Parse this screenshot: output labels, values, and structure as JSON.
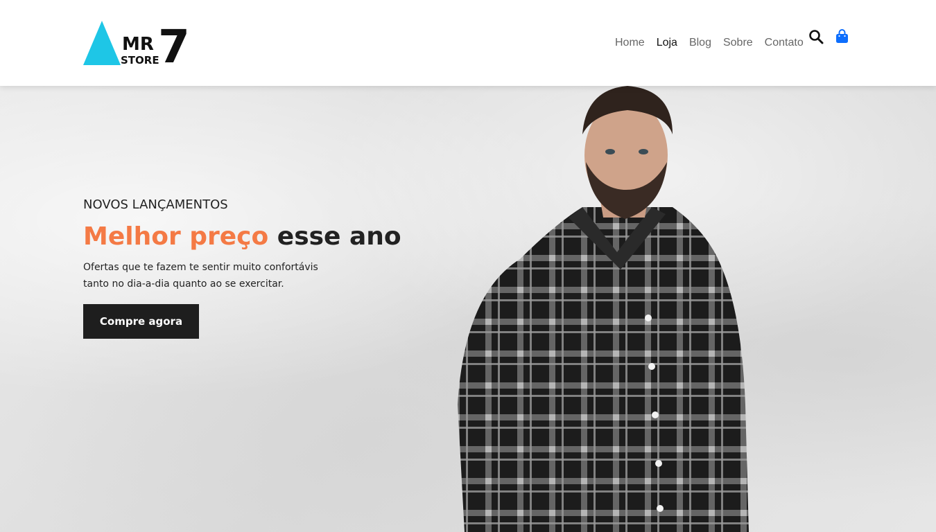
{
  "brand": {
    "logo_text_top": "MR",
    "logo_text_bottom": "STORE",
    "logo_number": "7",
    "accent_color": "#1ec6e6"
  },
  "nav": {
    "items": [
      {
        "label": "Home",
        "active": false
      },
      {
        "label": "Loja",
        "active": true
      },
      {
        "label": "Blog",
        "active": false
      },
      {
        "label": "Sobre",
        "active": false
      },
      {
        "label": "Contato",
        "active": false
      }
    ],
    "icons": [
      "search-icon",
      "cart-icon"
    ],
    "cart_icon_color": "#0d6efd"
  },
  "hero": {
    "eyebrow": "NOVOS LANÇAMENTOS",
    "headline_accent": "Melhor preço",
    "headline_rest": " esse ano",
    "subtitle_line1": "Ofertas que te fazem te sentir muito confortávis",
    "subtitle_line2": "tanto no dia-a-dia quanto ao se exercitar.",
    "cta_label": "Compre agora",
    "accent_color": "#f47a45"
  }
}
